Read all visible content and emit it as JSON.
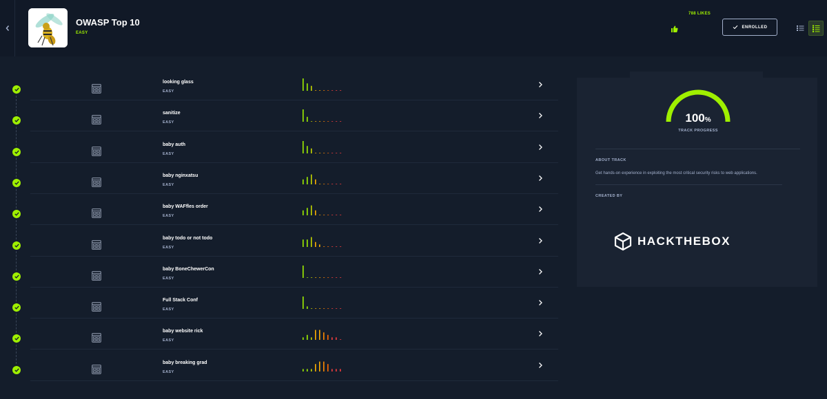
{
  "header": {
    "title": "OWASP Top 10",
    "difficulty": "EASY",
    "likes": "788 LIKES",
    "enrolled_label": "ENROLLED"
  },
  "challenges": [
    {
      "name": "looking glass",
      "difficulty": "EASY",
      "rating_bars": [
        5,
        3,
        2,
        0,
        0,
        0,
        0,
        0,
        0,
        0
      ]
    },
    {
      "name": "sanitize",
      "difficulty": "EASY",
      "rating_bars": [
        5,
        2,
        0,
        0,
        0,
        0,
        0,
        0,
        0,
        0
      ]
    },
    {
      "name": "baby auth",
      "difficulty": "EASY",
      "rating_bars": [
        5,
        3,
        2,
        0,
        0,
        0,
        0,
        0,
        0,
        0
      ]
    },
    {
      "name": "baby nginxatsu",
      "difficulty": "EASY",
      "rating_bars": [
        2,
        3,
        4,
        2,
        0,
        0,
        0,
        0,
        0,
        0
      ]
    },
    {
      "name": "baby WAFfles order",
      "difficulty": "EASY",
      "rating_bars": [
        2,
        3,
        4,
        2,
        0,
        0,
        0,
        0,
        0,
        0
      ]
    },
    {
      "name": "baby todo or not todo",
      "difficulty": "EASY",
      "rating_bars": [
        3,
        3,
        4,
        2,
        1,
        0,
        0,
        0,
        0,
        0
      ]
    },
    {
      "name": "baby BoneChewerCon",
      "difficulty": "EASY",
      "rating_bars": [
        5,
        0,
        0,
        0,
        0,
        0,
        0,
        0,
        0,
        0
      ]
    },
    {
      "name": "Full Stack Conf",
      "difficulty": "EASY",
      "rating_bars": [
        5,
        1,
        0,
        0,
        0,
        0,
        0,
        0,
        0,
        0
      ]
    },
    {
      "name": "baby website rick",
      "difficulty": "EASY",
      "rating_bars": [
        1,
        2,
        1,
        4,
        4,
        3,
        2,
        1,
        1,
        0
      ]
    },
    {
      "name": "baby breaking grad",
      "difficulty": "EASY",
      "rating_bars": [
        1,
        1,
        1,
        3,
        4,
        4,
        3,
        1,
        1,
        1
      ]
    }
  ],
  "panel": {
    "progress": "100",
    "progress_unit": "%",
    "progress_fraction": 1.0,
    "progress_label": "TRACK PROGRESS",
    "about_heading": "ABOUT TRACK",
    "about_text": "Get hands-on experience in exploiting the most critical security risks to web applications.",
    "created_heading": "CREATED BY",
    "creator_logo_text": "HACKTHEBOX"
  },
  "icons": {
    "back": "chevron-left-icon",
    "like": "thumbs-up-icon",
    "check": "check-icon",
    "challenge": "web-window-icon",
    "row_arrow": "chevron-right-icon",
    "view_compact": "compact-list-icon",
    "view_list": "list-icon"
  },
  "colors": {
    "accent": "#9fef00",
    "background": "#141d2b",
    "header_bg": "#111927",
    "panel_bg": "#1a2332",
    "muted_text": "#a4b1cd",
    "bar_ramp": [
      "#9fef00",
      "#9fef00",
      "#c5d600",
      "#ffaf00",
      "#ffaf00",
      "#ff8a00",
      "#ff6b00",
      "#ff3e3e",
      "#ff3e3e",
      "#ff3e3e"
    ]
  }
}
